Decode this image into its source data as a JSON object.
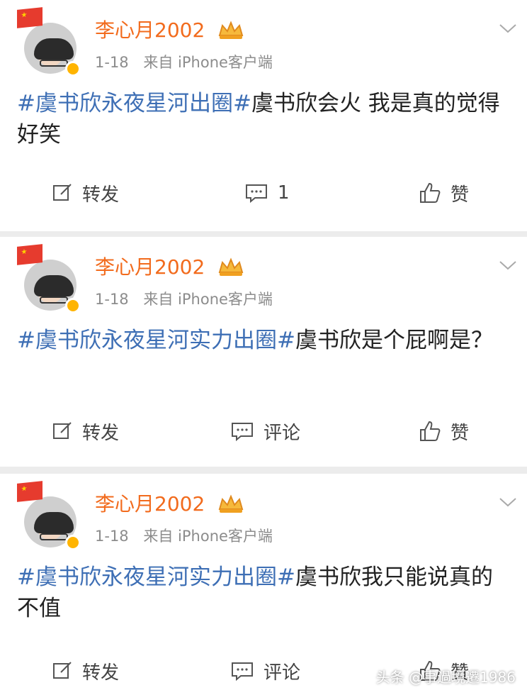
{
  "posts": [
    {
      "user": "李心月2002",
      "date": "1-18",
      "source": "来自 iPhone客户端",
      "tag1": "#虞书欣永夜星河出圈#",
      "text_a": "虞书欣会火 我是真的觉得好笑",
      "repost": "转发",
      "comment": "1",
      "like": "赞"
    },
    {
      "user": "李心月2002",
      "date": "1-18",
      "source": "来自 iPhone客户端",
      "tag1": "#虞书欣永夜星河实力出圈#",
      "text_a": "虞书欣是个屁啊是？",
      "repost": "转发",
      "comment": "评论",
      "like": "赞"
    },
    {
      "user": "李心月2002",
      "date": "1-18",
      "source": "来自 iPhone客户端",
      "tag1": "#虞书欣永夜星河实力出圈#",
      "text_a": "虞书欣我只能说真的不值",
      "repost": "转发",
      "comment": "评论",
      "like": "赞"
    }
  ],
  "watermark": "头条 @事過境遷1986",
  "colors": {
    "username": "#f26b1d",
    "tag": "#3e6fb5",
    "background": "#ececec"
  }
}
